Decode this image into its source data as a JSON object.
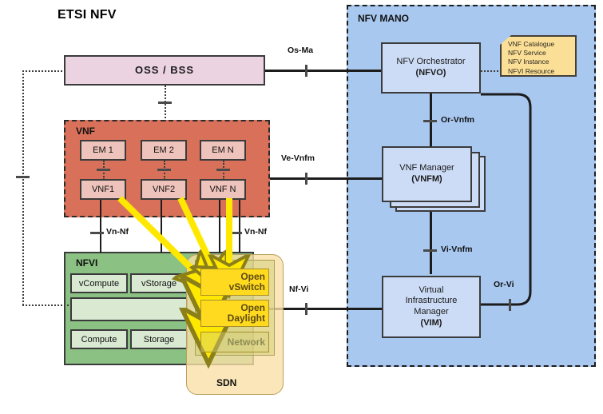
{
  "diagram": {
    "title": "ETSI NFV"
  },
  "colors": {
    "vnf_zone": "#d9715a",
    "nfvi_zone": "#8bc183",
    "mano_zone": "#a8c8f0",
    "sdn_zone": "#f9e0a6",
    "oss_box": "#ecd3e2",
    "sdn_item": "#ffda1e",
    "mano_node": "#ccdcf6",
    "note": "#fbdf96",
    "arrow": "#ffe800"
  },
  "oss": {
    "label": "OSS / BSS"
  },
  "vnf": {
    "zone_label": "VNF",
    "elements": [
      {
        "em": "EM 1",
        "vnf": "VNF1"
      },
      {
        "em": "EM 2",
        "vnf": "VNF2"
      },
      {
        "em": "EM N",
        "vnf": "VNF N"
      }
    ]
  },
  "nfvi": {
    "zone_label": "NFVI",
    "virtual_resources": [
      "vCompute",
      "vStorage"
    ],
    "virtualisation_layer": "",
    "hardware_resources": [
      "Compute",
      "Storage"
    ]
  },
  "sdn": {
    "zone_label": "SDN",
    "items": [
      {
        "label": "Open\nvSwitch",
        "line1": "Open",
        "line2": "vSwitch",
        "active": true
      },
      {
        "label": "Open\nDaylight",
        "line1": "Open",
        "line2": "Daylight",
        "active": true
      },
      {
        "label": "Network",
        "line1": "Network",
        "line2": "",
        "active": false
      }
    ]
  },
  "mano": {
    "zone_label": "NFV MANO",
    "nodes": [
      {
        "line1": "NFV Orchestrator",
        "line2": "(NFVO)",
        "acronym": "NFVO"
      },
      {
        "line1": "VNF Manager",
        "line2": "(VNFM)",
        "acronym": "VNFM"
      },
      {
        "line1": "Virtual",
        "line2": "Infrastructure",
        "line3": "Manager",
        "line4": "(VIM)",
        "acronym": "VIM"
      }
    ],
    "note": {
      "lines": [
        "VNF Catalogue",
        "NFV Service",
        "NFV Instance",
        "NFVI Resource"
      ]
    }
  },
  "reference_points": {
    "os_ma": "Os-Ma",
    "ve_vnfm": "Ve-Vnfm",
    "nf_vi": "Nf-Vi",
    "or_vnfm": "Or-Vnfm",
    "vi_vnfm": "Vi-Vnfm",
    "or_vi": "Or-Vi",
    "vn_nf_left": "Vn-Nf",
    "vn_nf_right": "Vn-Nf"
  }
}
